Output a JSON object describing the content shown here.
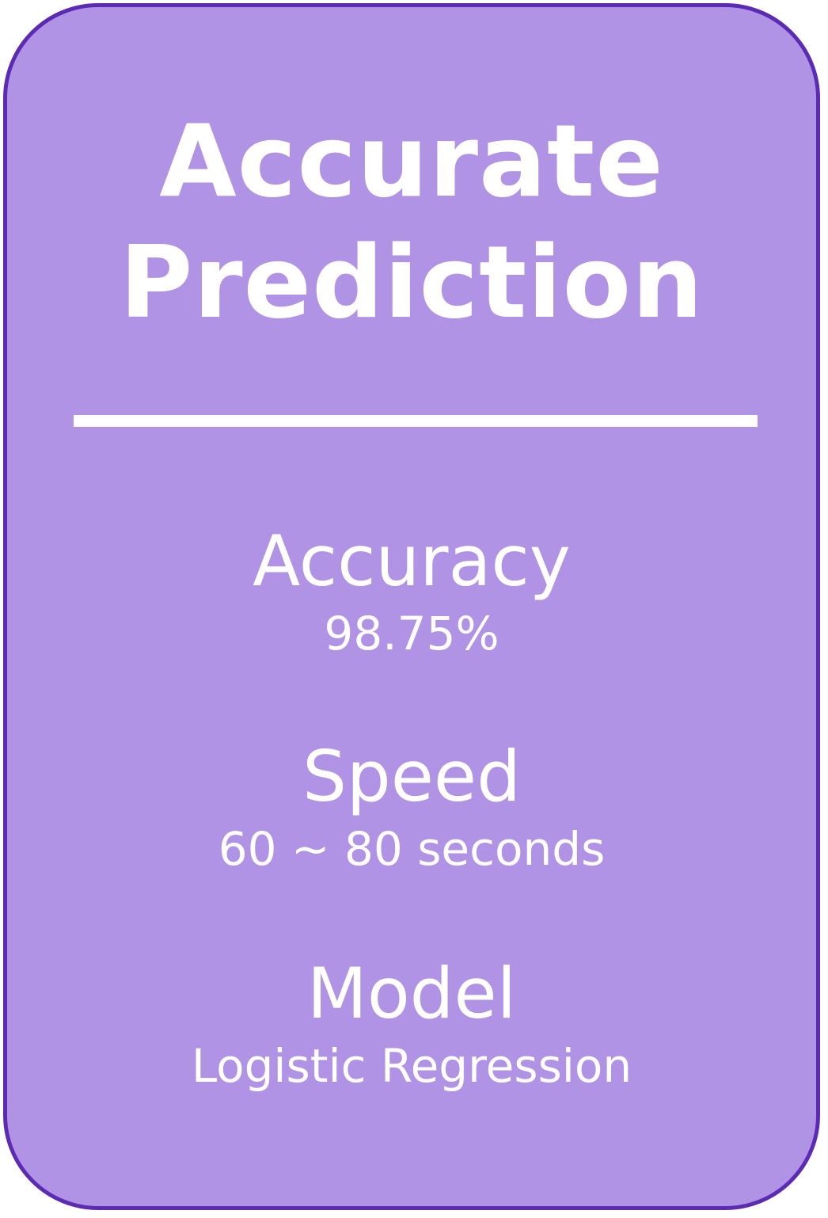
{
  "card": {
    "title_line1": "Accurate",
    "title_line2": "Prediction",
    "colors": {
      "background": "#b193e5",
      "border": "#5b2bb3",
      "text": "#ffffff"
    }
  },
  "metrics": [
    {
      "label": "Accuracy",
      "value": "98.75%"
    },
    {
      "label": "Speed",
      "value": "60 ~ 80 seconds"
    },
    {
      "label": "Model",
      "value": "Logistic Regression"
    }
  ]
}
